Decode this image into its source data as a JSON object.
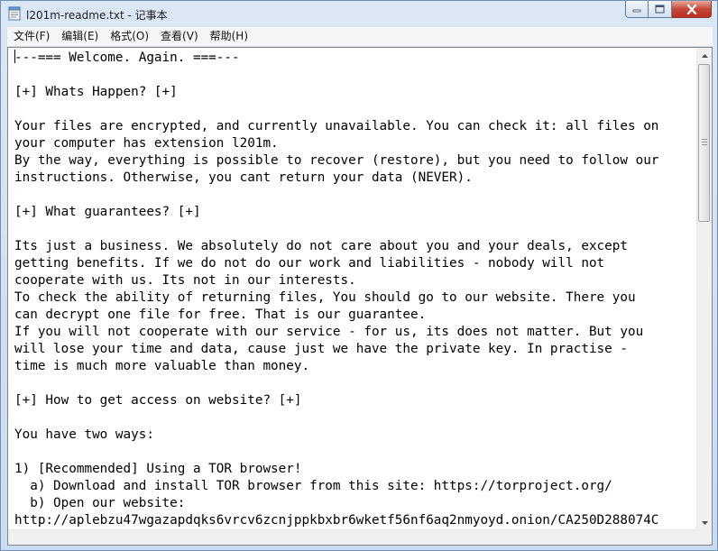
{
  "window": {
    "title": "l201m-readme.txt - 记事本"
  },
  "menu": [
    {
      "label": "文件(F)",
      "name": "menu-file"
    },
    {
      "label": "编辑(E)",
      "name": "menu-edit"
    },
    {
      "label": "格式(O)",
      "name": "menu-format"
    },
    {
      "label": "查看(V)",
      "name": "menu-view"
    },
    {
      "label": "帮助(H)",
      "name": "menu-help"
    }
  ],
  "document": {
    "lines": [
      "---=== Welcome. Again. ===---",
      "",
      "[+] Whats Happen? [+]",
      "",
      "Your files are encrypted, and currently unavailable. You can check it: all files on",
      "your computer has extension l201m.",
      "By the way, everything is possible to recover (restore), but you need to follow our",
      "instructions. Otherwise, you cant return your data (NEVER).",
      "",
      "[+] What guarantees? [+]",
      "",
      "Its just a business. We absolutely do not care about you and your deals, except",
      "getting benefits. If we do not do our work and liabilities - nobody will not",
      "cooperate with us. Its not in our interests.",
      "To check the ability of returning files, You should go to our website. There you",
      "can decrypt one file for free. That is our guarantee.",
      "If you will not cooperate with our service - for us, its does not matter. But you",
      "will lose your time and data, cause just we have the private key. In practise -",
      "time is much more valuable than money.",
      "",
      "[+] How to get access on website? [+]",
      "",
      "You have two ways:",
      "",
      "1) [Recommended] Using a TOR browser!",
      "  a) Download and install TOR browser from this site: https://torproject.org/",
      "  b) Open our website:",
      "http://aplebzu47wgazapdqks6vrcv6zcnjppkbxbr6wketf56nf6aq2nmyoyd.onion/CA250D288074C"
    ]
  }
}
